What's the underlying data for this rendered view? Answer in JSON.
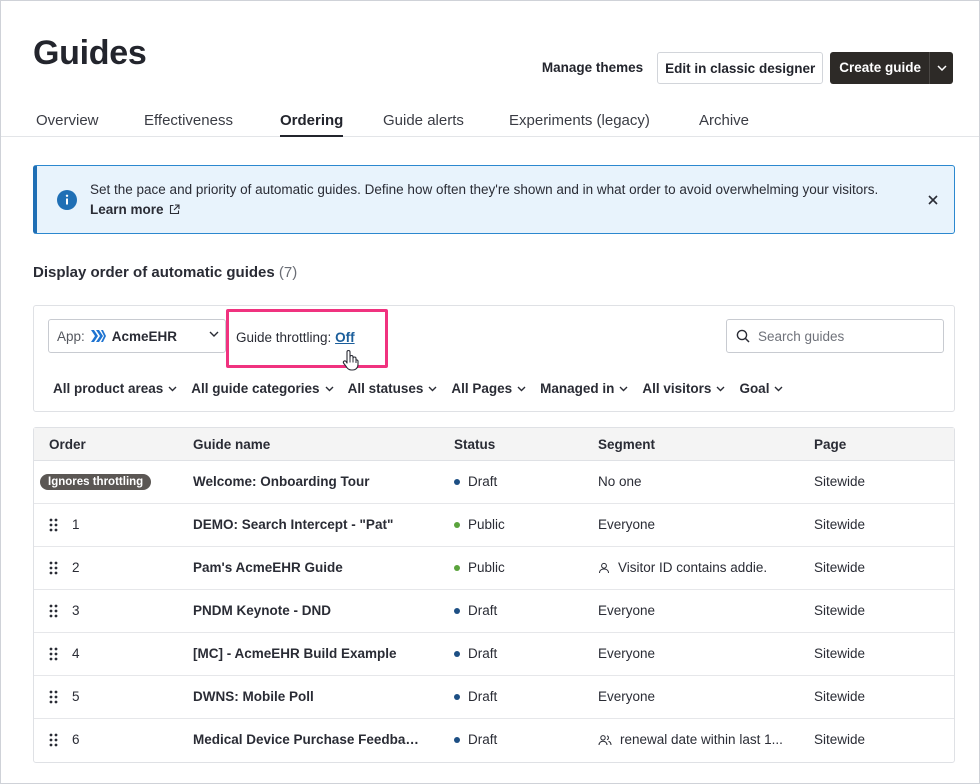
{
  "header": {
    "title": "Guides",
    "manage_themes": "Manage themes",
    "edit_classic": "Edit in classic designer",
    "create_guide": "Create guide"
  },
  "tabs": [
    {
      "label": "Overview"
    },
    {
      "label": "Effectiveness"
    },
    {
      "label": "Ordering"
    },
    {
      "label": "Guide alerts"
    },
    {
      "label": "Experiments (legacy)"
    },
    {
      "label": "Archive"
    }
  ],
  "active_tab": "Ordering",
  "banner": {
    "message": "Set the pace and priority of automatic guides. Define how often they're shown and in what order to avoid overwhelming your visitors.",
    "learn_more": "Learn more"
  },
  "section": {
    "title": "Display order of automatic guides",
    "count": "(7)"
  },
  "toolbar": {
    "app_label": "App:",
    "app_value": "AcmeEHR",
    "throttling_label": "Guide throttling:",
    "throttling_value": "Off",
    "search_placeholder": "Search guides",
    "filters": [
      {
        "label": "All product areas"
      },
      {
        "label": "All guide categories"
      },
      {
        "label": "All statuses"
      },
      {
        "label": "All Pages"
      },
      {
        "label": "Managed in"
      },
      {
        "label": "All visitors"
      },
      {
        "label": "Goal"
      }
    ]
  },
  "table": {
    "columns": [
      "Order",
      "Guide name",
      "Status",
      "Segment",
      "Page"
    ],
    "rows": [
      {
        "order": "Ignores throttling",
        "name": "Welcome: Onboarding Tour",
        "status": "Draft",
        "segment": "No one",
        "segment_icon": "",
        "page": "Sitewide"
      },
      {
        "order": "1",
        "name": "DEMO: Search Intercept - \"Pat\"",
        "status": "Public",
        "segment": "Everyone",
        "segment_icon": "",
        "page": "Sitewide"
      },
      {
        "order": "2",
        "name": "Pam's AcmeEHR Guide",
        "status": "Public",
        "segment": "Visitor ID contains addie.",
        "segment_icon": "person-icon",
        "page": "Sitewide"
      },
      {
        "order": "3",
        "name": "PNDM Keynote - DND",
        "status": "Draft",
        "segment": "Everyone",
        "segment_icon": "",
        "page": "Sitewide"
      },
      {
        "order": "4",
        "name": "[MC] - AcmeEHR Build Example",
        "status": "Draft",
        "segment": "Everyone",
        "segment_icon": "",
        "page": "Sitewide"
      },
      {
        "order": "5",
        "name": "DWNS: Mobile Poll",
        "status": "Draft",
        "segment": "Everyone",
        "segment_icon": "",
        "page": "Sitewide"
      },
      {
        "order": "6",
        "name": "Medical Device Purchase Feedback ...",
        "status": "Draft",
        "segment": "renewal date within last 1...",
        "segment_icon": "people-icon",
        "page": "Sitewide"
      }
    ]
  },
  "colors": {
    "draft": "#1d4f84",
    "public": "#5aa33c",
    "highlight": "#f0327f",
    "info": "#1f6fb5"
  }
}
